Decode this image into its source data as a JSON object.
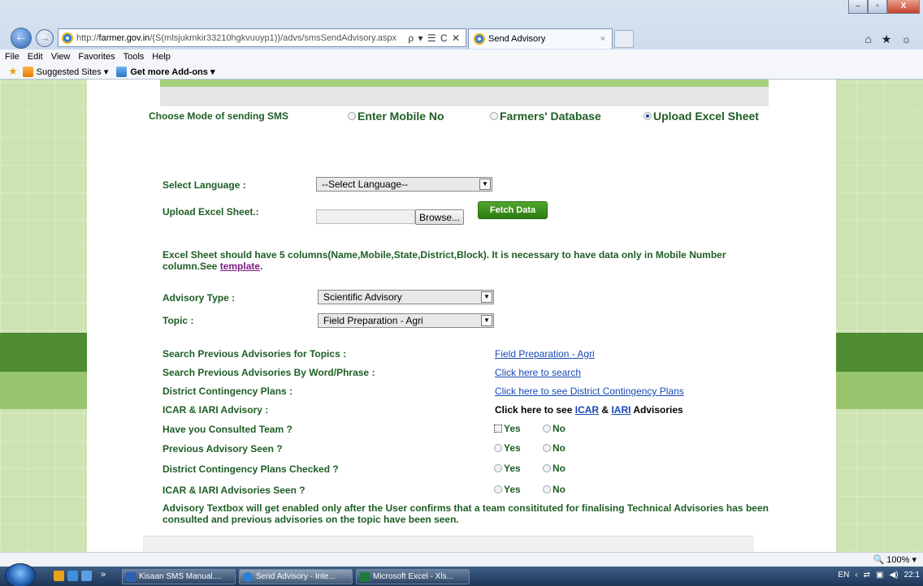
{
  "window": {
    "minimize": "–",
    "maximize": "▫",
    "close": "X"
  },
  "browser": {
    "address_prefix": "http://",
    "address_domain": "farmer.gov.in",
    "address_path": "/(S(mlsjukmkir33210hgkvuuyp1))/advs/smsSendAdvisory.aspx",
    "address_tools": "ρ ▾ ☰ C ✕",
    "tab_title": "Send Advisory",
    "tab_close": "×",
    "toolbar_icons": "⌂ ★ ☼"
  },
  "menubar": [
    "File",
    "Edit",
    "View",
    "Favorites",
    "Tools",
    "Help"
  ],
  "favbar": {
    "suggested": "Suggested Sites ▾",
    "addons": "Get more Add-ons ▾"
  },
  "form": {
    "mode_label": "Choose Mode of sending SMS",
    "mode_options": [
      {
        "label": "Enter Mobile No",
        "selected": false
      },
      {
        "label": "Farmers' Database",
        "selected": false
      },
      {
        "label": "Upload Excel Sheet",
        "selected": true
      }
    ],
    "language_label": "Select Language :",
    "language_value": "--Select Language--",
    "upload_label": "Upload Excel Sheet.:",
    "browse_label": "Browse...",
    "fetch_label": "Fetch Data",
    "excel_note": "Excel Sheet should have 5 columns(Name,Mobile,State,District,Block). It is necessary to have data only in Mobile Number column.See",
    "template_link": "template",
    "advisory_type_label": "Advisory Type :",
    "advisory_type_value": "Scientific Advisory",
    "topic_label": "Topic :",
    "topic_value": "Field Preparation - Agri",
    "rows": [
      {
        "label": "Search Previous Advisories for Topics :",
        "link": "Field Preparation - Agri"
      },
      {
        "label": "Search Previous Advisories By Word/Phrase :",
        "link": "Click here to search"
      },
      {
        "label": "District Contingency Plans :",
        "link": "Click here to see District Contingency Plans"
      }
    ],
    "icar_label": "ICAR & IARI Advisory :",
    "icar_prefix": "Click here to see",
    "icar_link": "ICAR",
    "icar_amp": "&",
    "iari_link": "IARI",
    "icar_suffix": "Advisories",
    "questions": [
      {
        "label": "Have you Consulted Team ?",
        "yes": "Yes",
        "no": "No"
      },
      {
        "label": "Previous Advisory Seen ?",
        "yes": "Yes",
        "no": "No"
      },
      {
        "label": "District Contingency Plans Checked ?",
        "yes": "Yes",
        "no": "No"
      },
      {
        "label": "ICAR & IARI Advisories Seen ?",
        "yes": "Yes",
        "no": "No"
      }
    ],
    "advisory_note": "Advisory Textbox will get enabled only after the User confirms that a team consitituted for finalising Technical Advisories has been consulted and previous advisories on the topic have been seen."
  },
  "statusbar": {
    "zoom": "100%"
  },
  "taskbar": {
    "items": [
      {
        "label": "Kisaan SMS Manual....",
        "icon_color": "#2b5fb3"
      },
      {
        "label": "Send Advisory - Inte...",
        "icon_color": "#2a7fd6"
      },
      {
        "label": "Microsoft Excel - Xls...",
        "icon_color": "#1f7a3a"
      }
    ],
    "overflow": "»",
    "lang": "EN",
    "arrow": "‹",
    "clock": "22:1"
  },
  "colors": {
    "label_green": "#1e5e25",
    "link_blue": "#1a49b5",
    "band_dark": "#4f8b31",
    "band_light": "#97c46d"
  }
}
